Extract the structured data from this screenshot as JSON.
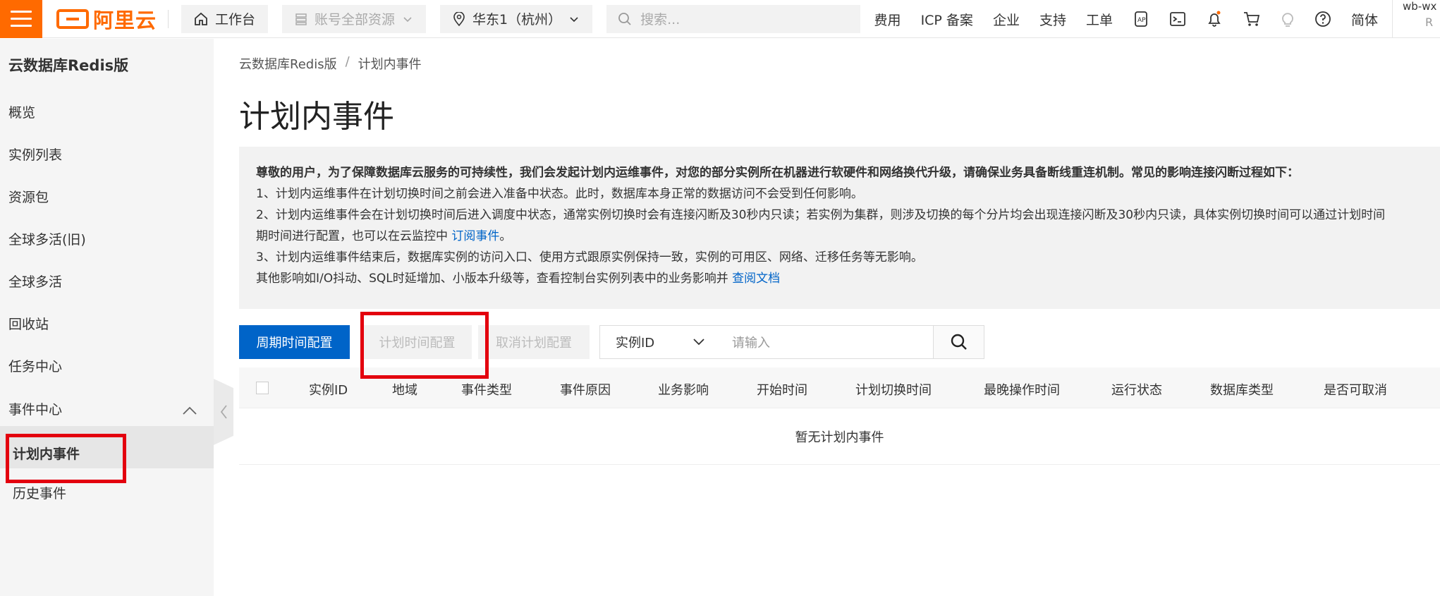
{
  "topbar": {
    "logo_text": "阿里云",
    "workbench_label": "工作台",
    "resource_label": "账号全部资源",
    "region_label": "华东1（杭州）",
    "search_placeholder": "搜索...",
    "nav": [
      "费用",
      "ICP 备案",
      "企业",
      "支持",
      "工单"
    ],
    "lang_label": "简体",
    "account_line1": "wb-wx",
    "account_line2": "R"
  },
  "sidebar": {
    "title": "云数据库Redis版",
    "items": [
      "概览",
      "实例列表",
      "资源包",
      "全球多活(旧)",
      "全球多活",
      "回收站",
      "任务中心",
      "事件中心"
    ],
    "sub_items": [
      "计划内事件",
      "历史事件"
    ]
  },
  "breadcrumb": [
    "云数据库Redis版",
    "/",
    "计划内事件"
  ],
  "page_title": "计划内事件",
  "notice": {
    "lead": "尊敬的用户，为了保障数据库云服务的可持续性，我们会发起计划内运维事件，对您的部分实例所在机器进行软硬件和网络换代升级，请确保业务具备断线重连机制。常见的影响连接闪断过程如下：",
    "line1": "1、计划内运维事件在计划切换时间之前会进入准备中状态。此时，数据库本身正常的数据访问不会受到任何影响。",
    "line2": "2、计划内运维事件会在计划切换时间后进入调度中状态，通常实例切换时会有连接闪断及30秒内只读；若实例为集群，则涉及切换的每个分片均会出现连接闪断及30秒内只读，具体实例切换时间可以通过计划时间",
    "line3_prefix": "期时间进行配置，也可以在云监控中 ",
    "line3_link": "订阅事件",
    "line3_suffix": "。",
    "line4": "3、计划内运维事件结束后，数据库实例的访问入口、使用方式跟原实例保持一致，实例的可用区、网络、迁移任务等无影响。",
    "line5_prefix": "其他影响如I/O抖动、SQL时延增加、小版本升级等，查看控制台实例列表中的业务影响并 ",
    "line5_link": "查阅文档"
  },
  "toolbar": {
    "periodic_config": "周期时间配置",
    "plan_time_config": "计划时间配置",
    "cancel_plan_config": "取消计划配置",
    "filter_select": "实例ID",
    "search_placeholder": "请输入"
  },
  "table": {
    "columns": [
      "实例ID",
      "地域",
      "事件类型",
      "事件原因",
      "业务影响",
      "开始时间",
      "计划切换时间",
      "最晚操作时间",
      "运行状态",
      "数据库类型",
      "是否可取消"
    ],
    "empty_text": "暂无计划内事件"
  },
  "colors": {
    "brand": "#ff6a00",
    "primary": "#0064c8",
    "highlight_box": "#e3000e"
  }
}
